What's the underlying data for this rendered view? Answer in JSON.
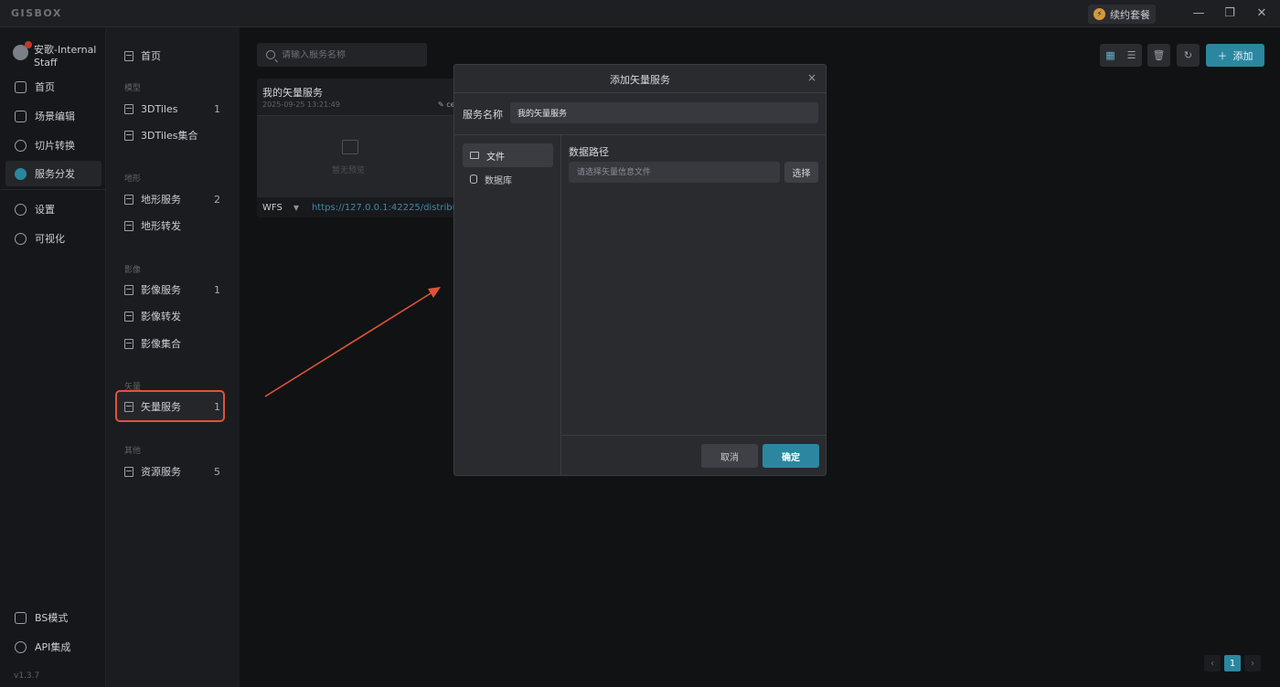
{
  "titlebar": {
    "brand": "GISBOX",
    "renew_label": "续约套餐",
    "renew_icon": "bolt-icon"
  },
  "user": {
    "name": "安歌-Internal Staff"
  },
  "nav": {
    "items": [
      {
        "label": "首页",
        "icon": "home-icon"
      },
      {
        "label": "场景编辑",
        "icon": "cube-icon"
      },
      {
        "label": "切片转换",
        "icon": "convert-icon"
      },
      {
        "label": "服务分发",
        "icon": "upload-icon"
      },
      {
        "label": "设置",
        "icon": "gear-icon"
      },
      {
        "label": "可视化",
        "icon": "visual-icon"
      }
    ],
    "bottom": [
      {
        "label": "BS模式",
        "icon": "code-icon"
      },
      {
        "label": "API集成",
        "icon": "link-icon"
      }
    ],
    "version": "v1.3.7"
  },
  "sub": {
    "home": "首页",
    "groups": {
      "model": "模型",
      "terrain": "地形",
      "imagery": "影像",
      "vector": "矢量",
      "other": "其他"
    },
    "items": {
      "tiles3d": {
        "label": "3DTiles",
        "count": "1"
      },
      "tiles3d_set": {
        "label": "3DTiles集合"
      },
      "terrain_service": {
        "label": "地形服务",
        "count": "2"
      },
      "terrain_forward": {
        "label": "地形转发"
      },
      "imagery_service": {
        "label": "影像服务",
        "count": "1"
      },
      "imagery_forward": {
        "label": "影像转发"
      },
      "imagery_set": {
        "label": "影像集合"
      },
      "vector_service": {
        "label": "矢量服务",
        "count": "1"
      },
      "resource_service": {
        "label": "资源服务",
        "count": "5"
      }
    }
  },
  "search": {
    "placeholder": "请输入服务名称"
  },
  "card": {
    "title": "我的矢量服务",
    "date": "2025-09-25 13:21:49",
    "tag": "ce",
    "preview_text": "暂无预览",
    "type": "WFS",
    "url": "https://127.0.0.1:42225/distribut"
  },
  "toolbar": {
    "add_label": "添加"
  },
  "pager": {
    "current": "1",
    "prev": "‹",
    "next": "›"
  },
  "modal": {
    "title": "添加矢量服务",
    "close": "×",
    "name_label": "服务名称",
    "name_value": "我的矢量服务",
    "sources": [
      {
        "label": "文件",
        "icon": "folder-icon"
      },
      {
        "label": "数据库",
        "icon": "database-icon"
      }
    ],
    "path_label": "数据路径",
    "path_placeholder": "请选择矢量信息文件",
    "choose_label": "选择",
    "cancel_label": "取消",
    "ok_label": "确定"
  },
  "colors": {
    "accent": "#2b87a0",
    "highlight": "#e0533a"
  }
}
